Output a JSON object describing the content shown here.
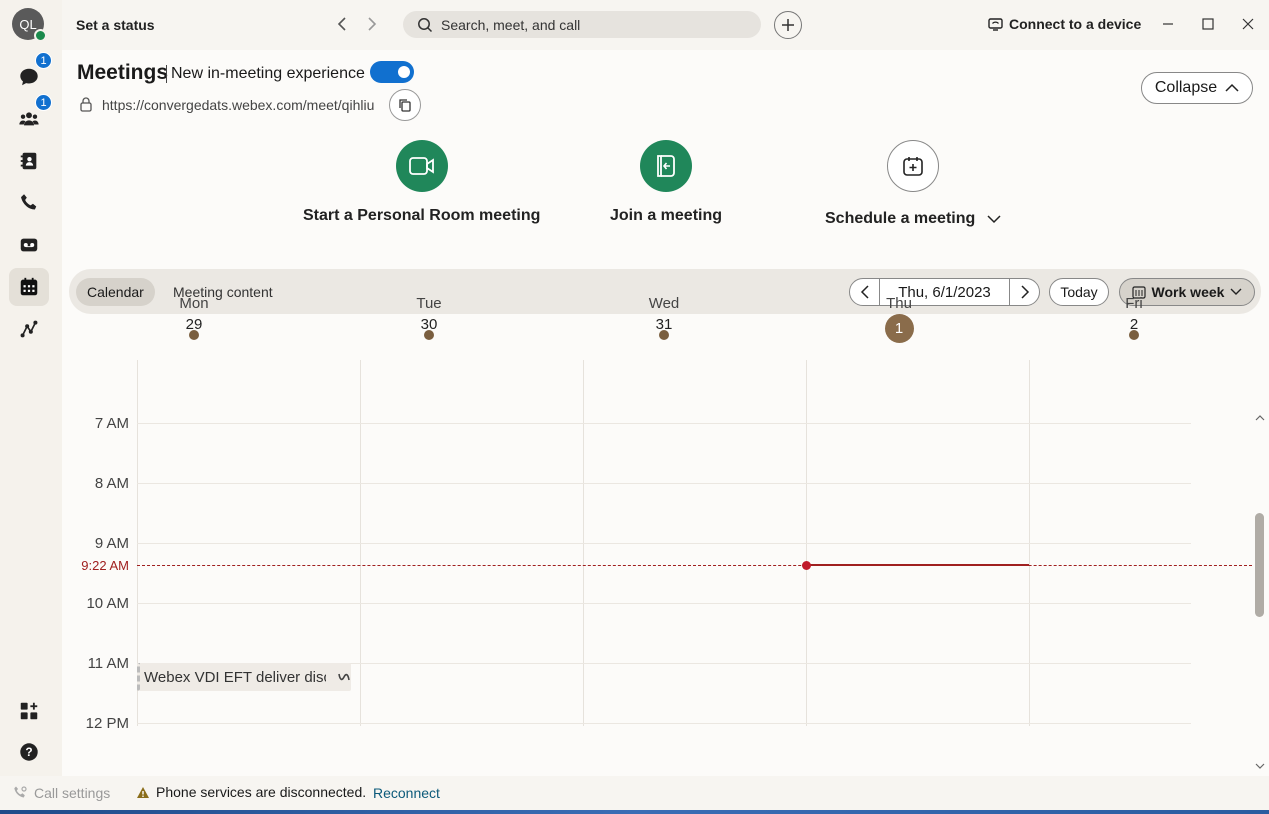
{
  "user": {
    "initials": "QL"
  },
  "titlebar": {
    "status": "Set a status",
    "search_placeholder": "Search, meet, and call",
    "connect": "Connect to a device"
  },
  "rail": {
    "messaging_badge": "1",
    "teams_badge": "1"
  },
  "meetings": {
    "title": "Meetings",
    "new_experience": "New in-meeting experience",
    "link": "https://convergedats.webex.com/meet/qihliu",
    "collapse": "Collapse",
    "actions": {
      "personal_room": "Start a Personal Room meeting",
      "join": "Join a meeting",
      "schedule": "Schedule a meeting"
    }
  },
  "calendar_bar": {
    "tab_calendar": "Calendar",
    "tab_content": "Meeting content",
    "date": "Thu, 6/1/2023",
    "today": "Today",
    "view": "Work week"
  },
  "days": [
    {
      "name": "Mon",
      "num": "29"
    },
    {
      "name": "Tue",
      "num": "30"
    },
    {
      "name": "Wed",
      "num": "31"
    },
    {
      "name": "Thu",
      "num": "1"
    },
    {
      "name": "Fri",
      "num": "2"
    }
  ],
  "hours": [
    "7 AM",
    "8 AM",
    "9 AM",
    "10 AM",
    "11 AM",
    "12 PM"
  ],
  "now_label": "9:22 AM",
  "event": {
    "title": "Webex VDI EFT deliver discussion"
  },
  "footer": {
    "call_settings": "Call settings",
    "warning": "Phone services are disconnected.",
    "reconnect": "Reconnect"
  },
  "colors": {
    "accent": "#1170cf",
    "green": "#20875a",
    "now_line": "#a02020"
  }
}
